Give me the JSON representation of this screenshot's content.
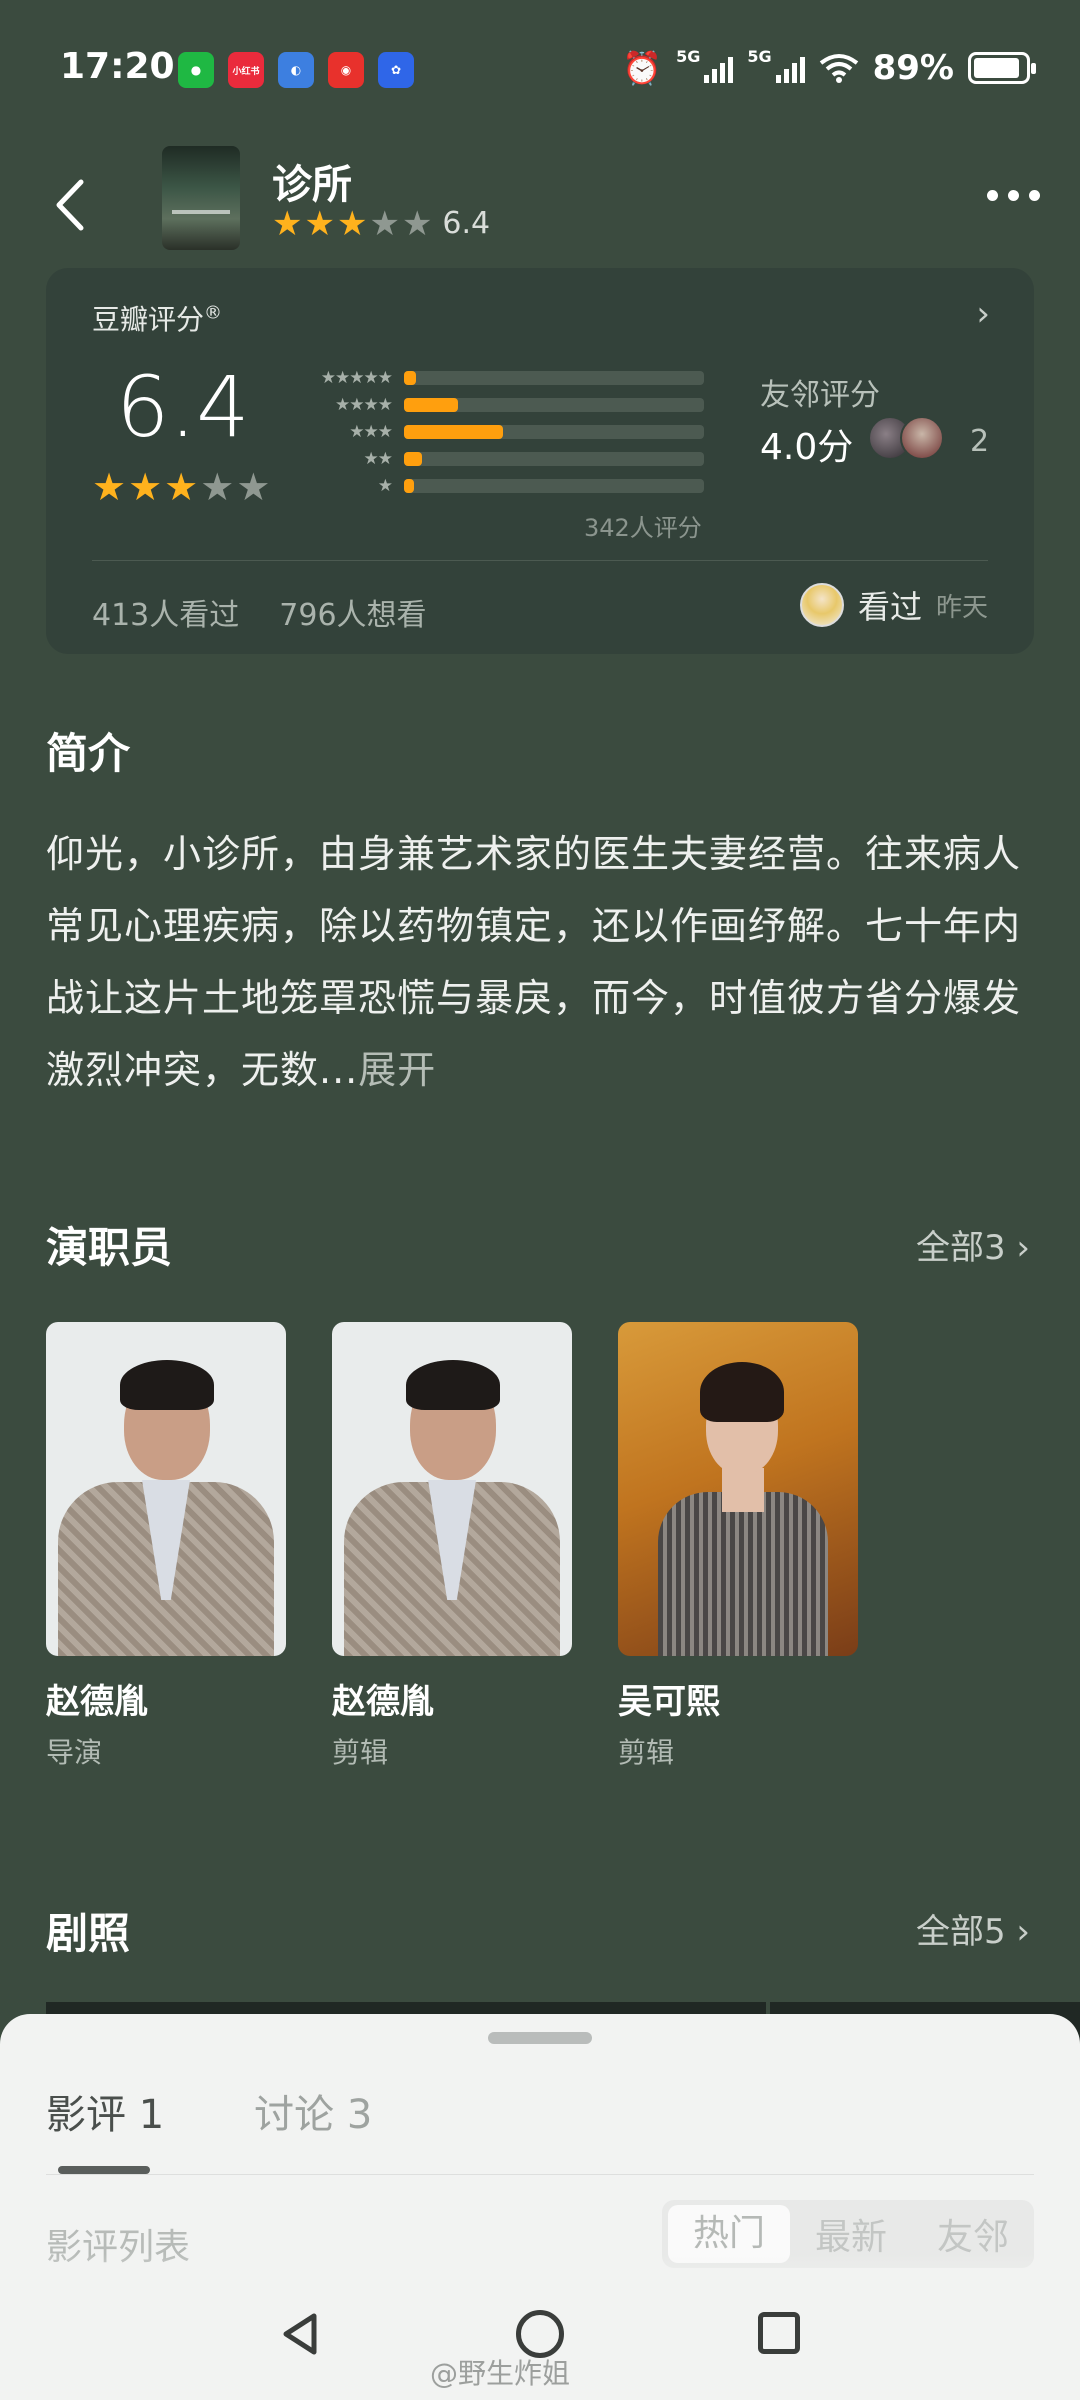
{
  "status_bar": {
    "time": "17:20",
    "app_icons": [
      {
        "name": "wechat-icon",
        "label": "",
        "color": "#1fb843"
      },
      {
        "name": "xiaohongshu-icon",
        "label": "小红书",
        "color": "#ea2b3c"
      },
      {
        "name": "browser-icon",
        "label": "",
        "color": "#3d7fe0"
      },
      {
        "name": "weibo-icon",
        "label": "",
        "color": "#e8312c"
      },
      {
        "name": "baidu-icon",
        "label": "",
        "color": "#2f66e8"
      }
    ],
    "signal_label_1": "5G",
    "signal_label_2": "5G",
    "battery": "89%",
    "battery_level": 0.89
  },
  "header": {
    "back_icon": "chevron-left-icon",
    "title": "诊所",
    "rating_stars": 3,
    "rating_value": "6.4",
    "more_icon": "more-horizontal-icon"
  },
  "rating_card": {
    "title": "豆瓣评分",
    "registered_mark": "®",
    "score": "6.4",
    "stars_filled": 3,
    "distribution": [
      {
        "stars": 5,
        "percent": 0.04
      },
      {
        "stars": 4,
        "percent": 0.18
      },
      {
        "stars": 3,
        "percent": 0.33
      },
      {
        "stars": 2,
        "percent": 0.06
      },
      {
        "stars": 1,
        "percent": 0.03
      }
    ],
    "rating_count": "342人评分",
    "friend_label": "友邻评分",
    "friend_score": "4.0分",
    "friend_count": "2",
    "watched": "413人看过",
    "want_to_watch": "796人想看",
    "my_status": "看过",
    "my_status_time": "昨天",
    "accent_color": "#ff9f0e"
  },
  "synopsis": {
    "heading": "简介",
    "text": "仰光，小诊所，由身兼艺术家的医生夫妻经营。往来病人常见心理疾病，除以药物镇定，还以作画纾解。七十年内战让这片土地笼罩恐慌与暴戾，而今，时值彼方省分爆发激烈冲突，无数...",
    "expand_label": "展开"
  },
  "cast": {
    "heading": "演职员",
    "see_all": "全部3",
    "members": [
      {
        "name": "赵德胤",
        "role": "导演"
      },
      {
        "name": "赵德胤",
        "role": "剪辑"
      },
      {
        "name": "吴可熙",
        "role": "剪辑"
      }
    ]
  },
  "stills": {
    "heading": "剧照",
    "see_all": "全部5"
  },
  "bottom_sheet": {
    "tabs": [
      {
        "label": "影评 1",
        "active": true
      },
      {
        "label": "讨论 3",
        "active": false
      }
    ],
    "list_label": "影评列表",
    "sort_options": [
      "热门",
      "最新",
      "友邻"
    ],
    "selected_sort": "热门"
  },
  "watermark": "@野生炸姐"
}
